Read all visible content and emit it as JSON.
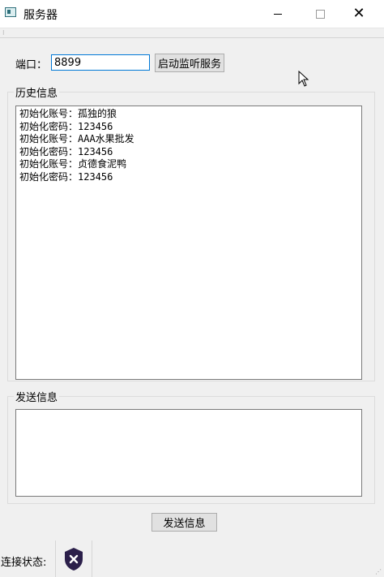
{
  "window": {
    "title": "服务器",
    "minimize_icon": "minimize-icon",
    "maximize_icon": "maximize-icon",
    "close_icon": "close-icon"
  },
  "port": {
    "label": "端口：",
    "value": "8899"
  },
  "start_button": {
    "label": "启动监听服务"
  },
  "history": {
    "group_title": "历史信息",
    "lines": [
      "初始化账号：孤独的狼",
      "初始化密码：123456",
      "初始化账号：AAA水果批发",
      "初始化密码：123456",
      "初始化账号：贞德食泥鸭",
      "初始化密码：123456"
    ]
  },
  "send": {
    "group_title": "发送信息",
    "message_value": "",
    "button_label": "发送信息"
  },
  "status": {
    "label": "连接状态:",
    "icon": "disconnected-shield-icon",
    "icon_color": "#2b1f4a"
  }
}
